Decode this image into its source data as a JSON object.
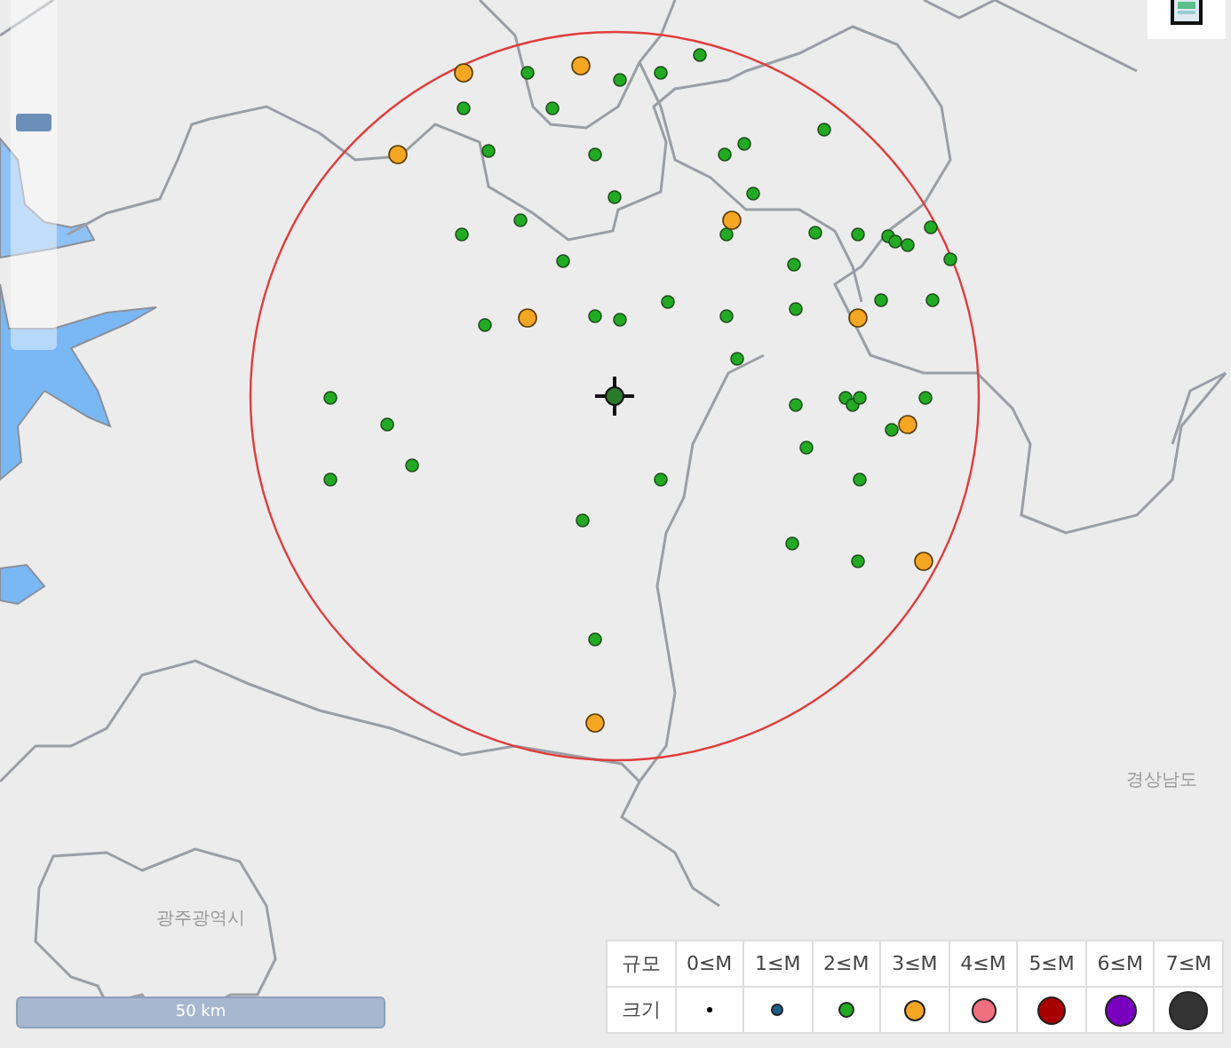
{
  "map": {
    "zoom_slider": {
      "level": 0.66
    },
    "region_labels": [
      "경상남도",
      "광주광역시"
    ],
    "scale_bar": "50 km"
  },
  "legend": {
    "header": "규모",
    "row_label": "크기",
    "items": [
      {
        "label": "0≤M",
        "color": "#000000"
      },
      {
        "label": "1≤M",
        "color": "#1e5f8a"
      },
      {
        "label": "2≤M",
        "color": "#22aa22"
      },
      {
        "label": "3≤M",
        "color": "#f5a623"
      },
      {
        "label": "4≤M",
        "color": "#f07080"
      },
      {
        "label": "5≤M",
        "color": "#a80000"
      },
      {
        "label": "6≤M",
        "color": "#7a00c0"
      },
      {
        "label": "7≤M",
        "color": "#333333"
      }
    ]
  }
}
